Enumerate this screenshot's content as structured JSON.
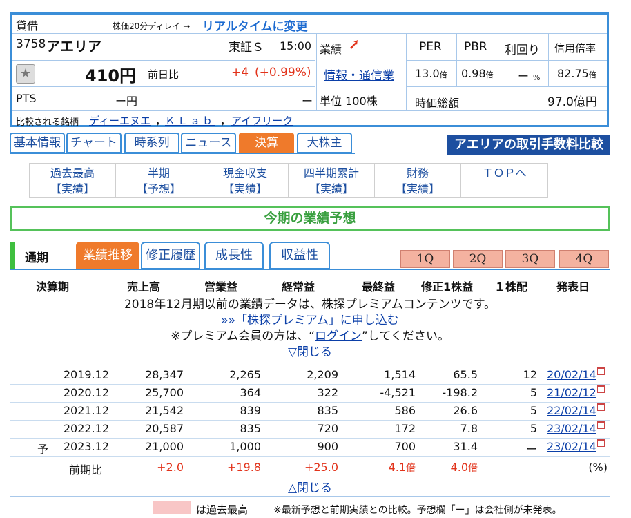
{
  "quote": {
    "lending": "貸借",
    "delay_note": "株価20分ディレイ →",
    "realtime_link": "リアルタイムに変更",
    "code": "3758",
    "name": "アエリア",
    "market": "東証Ｓ",
    "time": "15:00",
    "performance_label": "業績",
    "price": "410円",
    "prev_label": "前日比",
    "change": "+4",
    "change_pct": "(+0.99%)",
    "sector": "情報・通信業",
    "pts_label": "PTS",
    "pts_price": "ー円",
    "pts_change": "ー",
    "unit": "単位 100株",
    "per_label": "PER",
    "pbr_label": "PBR",
    "yield_label": "利回り",
    "margin_label": "信用倍率",
    "per_value": "13.0",
    "per_unit": "倍",
    "pbr_value": "0.98",
    "pbr_unit": "倍",
    "yield_value": "ー",
    "yield_unit": "%",
    "margin_value": "82.75",
    "margin_unit": "倍",
    "mcap_label": "時価総額",
    "mcap_value": "97.0億円",
    "compare_label": "比較される銘柄",
    "compare": [
      "ディーエヌエ",
      "ＫＬａｂ",
      "アイフリーク"
    ],
    "compare_sep": "，"
  },
  "tabs": [
    "基本情報",
    "チャート",
    "時系列",
    "ニュース",
    "決算",
    "大株主"
  ],
  "active_tab": "決算",
  "fee_banner": "アエリアの取引手数料比較",
  "subnav": [
    {
      "top": "過去最高",
      "bottom": "【実績】"
    },
    {
      "top": "半期",
      "bottom": "【予想】"
    },
    {
      "top": "現金収支",
      "bottom": "【実績】"
    },
    {
      "top": "四半期累計",
      "bottom": "【実績】"
    },
    {
      "top": "財務",
      "bottom": "【実績】"
    },
    {
      "top": "ＴＯＰへ",
      "bottom": ""
    }
  ],
  "forecast_title": "今期の業績予想",
  "period_label": "通期",
  "period_tabs": [
    "業績推移",
    "修正履歴",
    "成長性",
    "収益性"
  ],
  "quarters": [
    "1Q",
    "2Q",
    "3Q",
    "4Q"
  ],
  "table": {
    "headers": [
      "決算期",
      "売上高",
      "営業益",
      "経常益",
      "最終益",
      "修正1株益",
      "１株配",
      "発表日"
    ],
    "premium_msg": "2018年12月期以前の業績データは、株探プレミアムコンテンツです。",
    "premium_link": "»»「株探プレミアム」に申し込む",
    "login_pre": "※プレミアム会員の方は、“",
    "login_link": "ログイン",
    "login_post": "”してください。",
    "close_label": "▽閉じる",
    "rows": [
      {
        "prefix": "",
        "period": "2019.12",
        "sales": "28,347",
        "op": "2,265",
        "ord": "2,209",
        "net": "1,514",
        "eps": "65.5",
        "div": "12",
        "date": "20/02/14"
      },
      {
        "prefix": "",
        "period": "2020.12",
        "sales": "25,700",
        "op": "364",
        "ord": "322",
        "net": "-4,521",
        "eps": "-198.2",
        "div": "5",
        "date": "21/02/12"
      },
      {
        "prefix": "",
        "period": "2021.12",
        "sales": "21,542",
        "op": "839",
        "ord": "835",
        "net": "586",
        "eps": "26.6",
        "div": "5",
        "date": "22/02/14"
      },
      {
        "prefix": "",
        "period": "2022.12",
        "sales": "20,587",
        "op": "835",
        "ord": "720",
        "net": "172",
        "eps": "7.8",
        "div": "5",
        "date": "23/02/14"
      },
      {
        "prefix": "予",
        "period": "2023.12",
        "sales": "21,000",
        "op": "1,000",
        "ord": "900",
        "net": "700",
        "eps": "31.4",
        "div": "ー",
        "date": "23/02/14"
      }
    ],
    "yoy": {
      "label": "前期比",
      "sales": "+2.0",
      "op": "+19.8",
      "ord": "+25.0",
      "net": "4.1",
      "net_unit": "倍",
      "eps": "4.0",
      "eps_unit": "倍",
      "unit": "(%)"
    },
    "close_bottom": "△閉じる"
  },
  "legend": {
    "swatch_text": "は過去最高",
    "note": "※最新予想と前期実績との比較。予想欄「ー」は会社側が未発表。"
  },
  "colors": {
    "accent": "#3b8ed8",
    "active": "#ef7a2b",
    "positive": "#e2331b",
    "title_green": "#55c25a",
    "banner": "#1d4fa0"
  }
}
